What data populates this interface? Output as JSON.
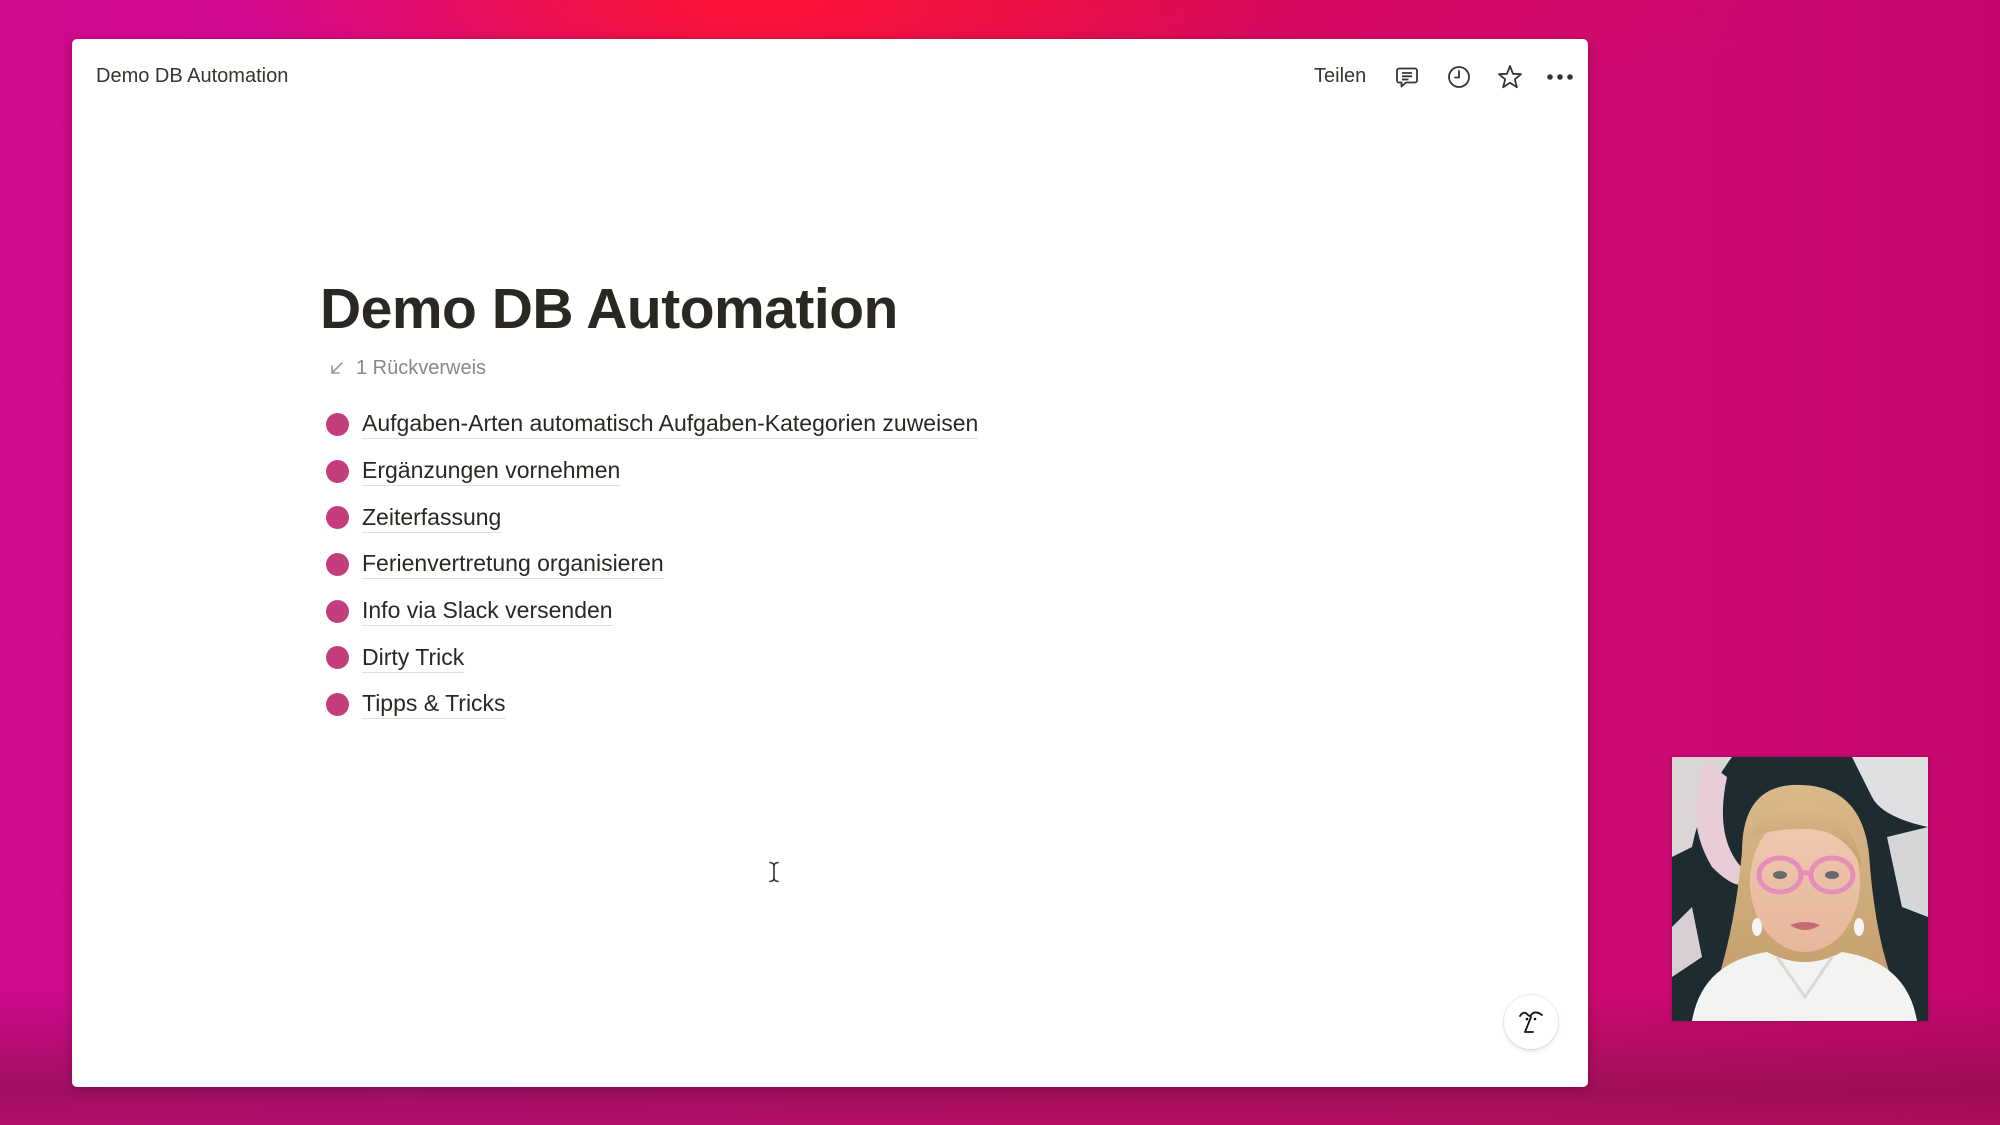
{
  "topbar": {
    "breadcrumb": "Demo DB Automation",
    "share_label": "Teilen",
    "icons": {
      "comments": "comment-icon",
      "updates": "clock-icon",
      "favorite": "star-icon",
      "more": "more-horizontal-icon"
    }
  },
  "page": {
    "title": "Demo DB Automation",
    "backlinks": "1 Rückverweis",
    "subpages": [
      {
        "label": "Aufgaben-Arten automatisch Aufgaben-Kategorien zuweisen"
      },
      {
        "label": "Ergänzungen vornehmen"
      },
      {
        "label": "Zeiterfassung"
      },
      {
        "label": "Ferienvertretung organisieren"
      },
      {
        "label": "Info via Slack versenden"
      },
      {
        "label": "Dirty Trick"
      },
      {
        "label": "Tipps & Tricks"
      }
    ],
    "bullet_color": "#c43e7d"
  },
  "help": {
    "icon": "help-face-icon"
  },
  "webcam": {
    "content": "presenter video feed"
  }
}
